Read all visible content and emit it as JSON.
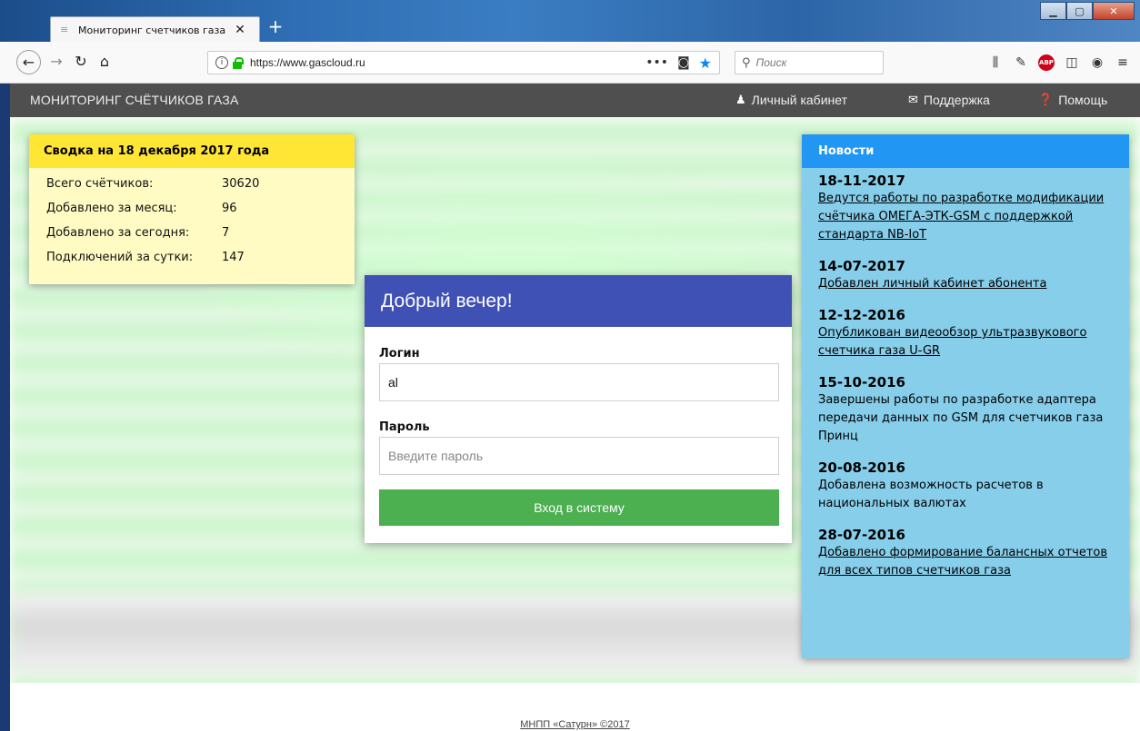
{
  "browser": {
    "tab_title": "Мониторинг счетчиков газа",
    "url": "https://www.gascloud.ru",
    "search_placeholder": "Поиск"
  },
  "site_nav": {
    "brand": "МОНИТОРИНГ СЧЁТЧИКОВ ГАЗА",
    "items": [
      {
        "label": "Личный кабинет",
        "icon": "user-icon"
      },
      {
        "label": "Поддержка",
        "icon": "envelope-icon"
      },
      {
        "label": "Помощь",
        "icon": "question-circle-icon"
      }
    ]
  },
  "summary": {
    "title": "Сводка на 18 декабря 2017 года",
    "rows": [
      {
        "label": "Всего счётчиков:",
        "value": "30620"
      },
      {
        "label": "Добавлено за месяц:",
        "value": "96"
      },
      {
        "label": "Добавлено за сегодня:",
        "value": "7"
      },
      {
        "label": "Подключений за сутки:",
        "value": "147"
      }
    ]
  },
  "login": {
    "greeting": "Добрый вечер!",
    "login_label": "Логин",
    "login_value": "al",
    "password_label": "Пароль",
    "password_placeholder": "Введите пароль",
    "submit_label": "Вход в систему"
  },
  "news": {
    "title": "Новости",
    "items": [
      {
        "date": "18-11-2017",
        "text": "Ведутся работы по разработке модификации счётчика ОМЕГА-ЭТК-GSM с поддержкой стандарта NB-IoT",
        "link": true
      },
      {
        "date": "14-07-2017",
        "text": "Добавлен личный кабинет абонента",
        "link": true
      },
      {
        "date": "12-12-2016",
        "text": "Опубликован видеообзор ультразвукового счетчика газа U-GR",
        "link": true
      },
      {
        "date": "15-10-2016",
        "text": "Завершены работы по разработке адаптера передачи данных по GSM для счетчиков газа Принц",
        "link": false
      },
      {
        "date": "20-08-2016",
        "text": "Добавлена возможность расчетов в национальных валютах",
        "link": false
      },
      {
        "date": "28-07-2016",
        "text": "Добавлено формирование балансных отчетов для всех типов счетчиков газа",
        "link": true
      }
    ]
  },
  "footer": "МНПП «Сатурн» ©2017",
  "colors": {
    "site_nav": "#4f4f4f",
    "summary_head": "#ffe534",
    "summary_body": "#fffbc3",
    "login_head": "#3f51b5",
    "login_button": "#4caf50",
    "news_head": "#2196f3",
    "news_body": "#87ceeb"
  }
}
